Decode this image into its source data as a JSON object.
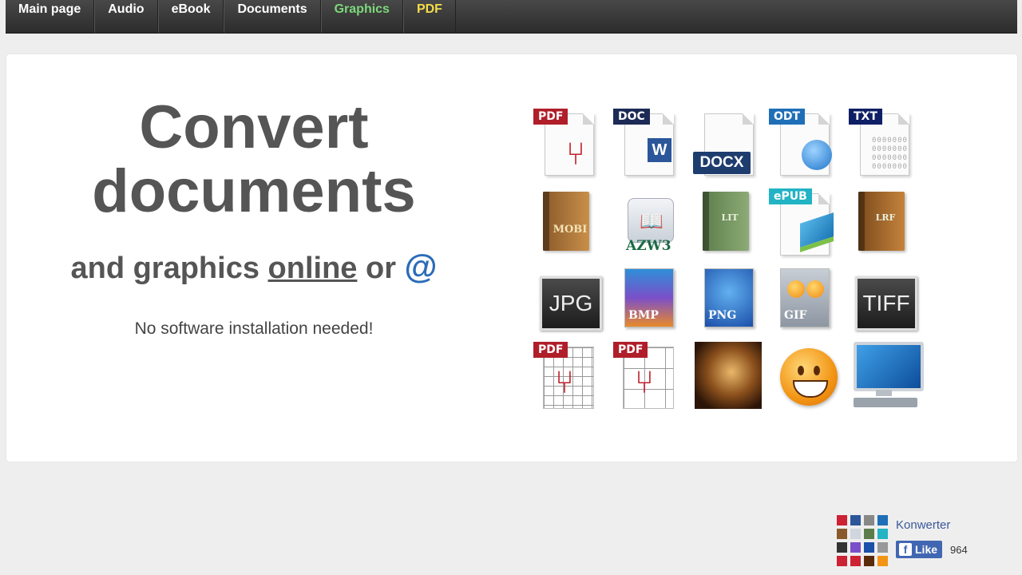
{
  "nav": {
    "items": [
      {
        "label": "Main page"
      },
      {
        "label": "Audio"
      },
      {
        "label": "eBook"
      },
      {
        "label": "Documents"
      },
      {
        "label": "Graphics"
      },
      {
        "label": "PDF"
      }
    ]
  },
  "hero": {
    "title_line1": "Convert",
    "title_line2": "documents",
    "subtitle_prefix": "and graphics",
    "subtitle_link": "online",
    "subtitle_or": "or",
    "subtitle_at": "@",
    "note": "No software installation needed!"
  },
  "formats": {
    "pdf": "PDF",
    "doc": "DOC",
    "docx": "DOCX",
    "odt": "ODT",
    "txt": "TXT",
    "mobi": "MOBI",
    "azw3": "AZW3",
    "lit": "LIT",
    "epub": "ePUB",
    "lrf": "LRF",
    "jpg": "JPG",
    "bmp": "BMP",
    "png": "PNG",
    "gif": "GIF",
    "tiff": "TIFF",
    "pdf_grid": "PDF",
    "pdf_puzzle": "PDF"
  },
  "facebook": {
    "page_name": "Konwerter",
    "like_label": "Like",
    "like_count": "964"
  },
  "colors": {
    "nav_graphics": "#7dd87a",
    "nav_pdf": "#f5dc4a",
    "title_text": "#555555",
    "at_sign": "#2b6cb8",
    "facebook_blue": "#4267b2"
  }
}
